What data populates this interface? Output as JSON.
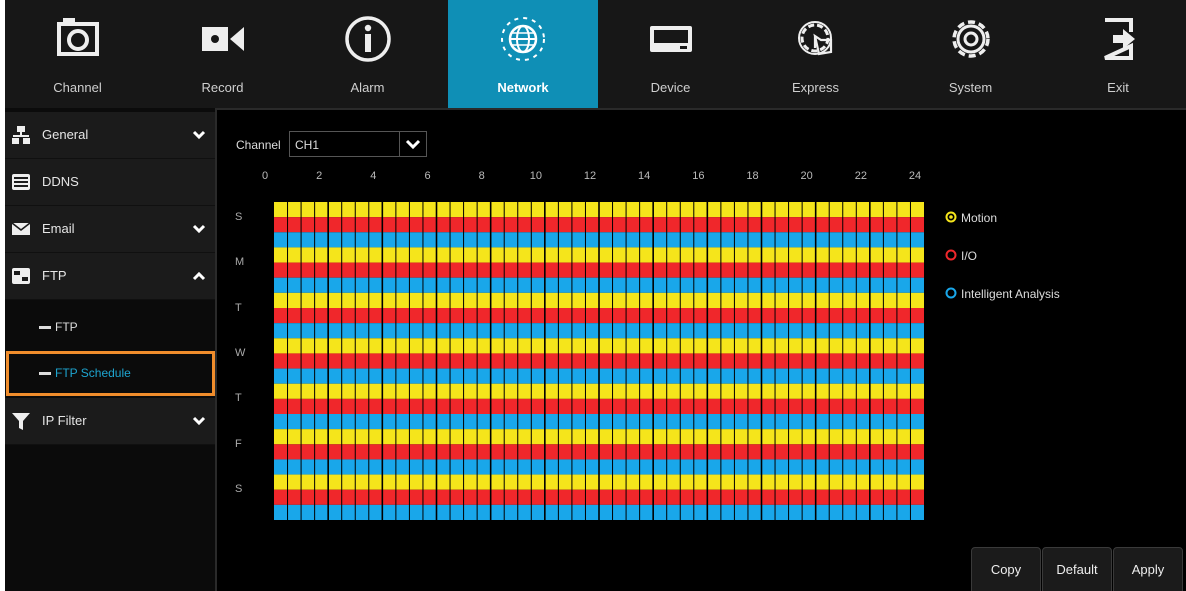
{
  "nav": {
    "tabs": [
      {
        "label": "Channel",
        "icon": "camera-icon",
        "active": false
      },
      {
        "label": "Record",
        "icon": "video-camera-icon",
        "active": false
      },
      {
        "label": "Alarm",
        "icon": "info-icon",
        "active": false
      },
      {
        "label": "Network",
        "icon": "globe-network-icon",
        "active": true
      },
      {
        "label": "Device",
        "icon": "hard-drive-icon",
        "active": false
      },
      {
        "label": "Express",
        "icon": "gear-hand-icon",
        "active": false
      },
      {
        "label": "System",
        "icon": "gear-icon",
        "active": false
      },
      {
        "label": "Exit",
        "icon": "exit-icon",
        "active": false
      }
    ]
  },
  "sidebar": {
    "items": [
      {
        "label": "General",
        "icon": "network-icon",
        "expand": "down"
      },
      {
        "label": "DDNS",
        "icon": "ddns-icon",
        "expand": ""
      },
      {
        "label": "Email",
        "icon": "envelope-icon",
        "expand": "down"
      },
      {
        "label": "FTP",
        "icon": "ftp-icon",
        "expand": "up"
      },
      {
        "label": "IP Filter",
        "icon": "filter-icon",
        "expand": "down"
      }
    ],
    "subitems": [
      {
        "label": "FTP",
        "selected": false
      },
      {
        "label": "FTP Schedule",
        "selected": true
      }
    ]
  },
  "channel": {
    "label": "Channel",
    "value": "CH1"
  },
  "schedule": {
    "hours": [
      "0",
      "2",
      "4",
      "6",
      "8",
      "10",
      "12",
      "14",
      "16",
      "18",
      "20",
      "22",
      "24"
    ],
    "days": [
      "S",
      "M",
      "T",
      "W",
      "T",
      "F",
      "S"
    ],
    "row_colors": [
      "#f5e51b",
      "#f0272b",
      "#19a7ea"
    ]
  },
  "legend": [
    {
      "label": "Motion",
      "color": "#f5e51b"
    },
    {
      "label": "I/O",
      "color": "#f0272b"
    },
    {
      "label": "Intelligent Analysis",
      "color": "#19a7ea"
    }
  ],
  "buttons": {
    "copy": "Copy",
    "default": "Default",
    "apply": "Apply"
  }
}
